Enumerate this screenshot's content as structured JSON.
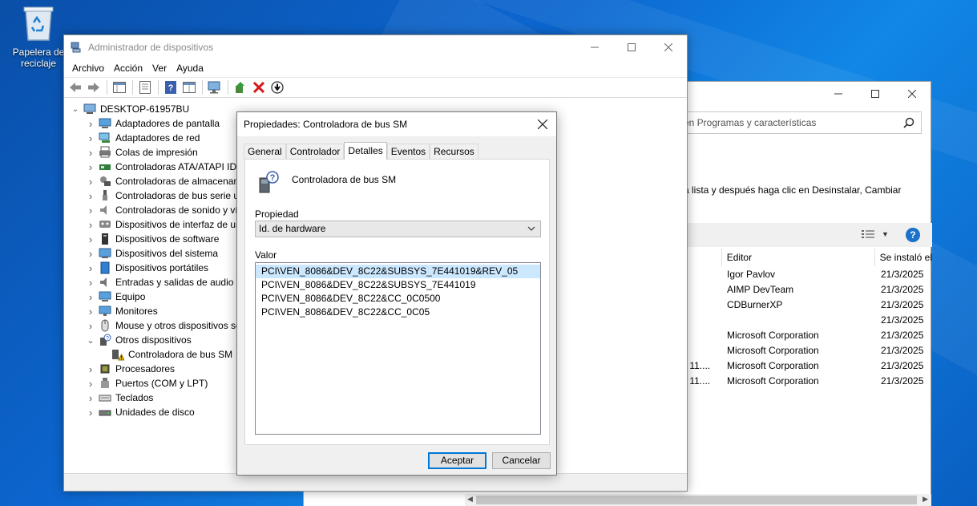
{
  "desktop": {
    "recycle_bin_label": "Papelera de reciclaje"
  },
  "programs_window": {
    "search_placeholder": "en Programas y características",
    "description": "a lista y después haga clic en Desinstalar, Cambiar",
    "columns": {
      "editor": "Editor",
      "installed": "Se instaló el"
    },
    "rows": [
      {
        "fragment": "",
        "editor": "Igor Pavlov",
        "date": "21/3/2025"
      },
      {
        "fragment": "",
        "editor": "AIMP DevTeam",
        "date": "21/3/2025"
      },
      {
        "fragment": "",
        "editor": "CDBurnerXP",
        "date": "21/3/2025"
      },
      {
        "fragment": "",
        "editor": "",
        "date": "21/3/2025"
      },
      {
        "fragment": "",
        "editor": "Microsoft Corporation",
        "date": "21/3/2025"
      },
      {
        "fragment": "",
        "editor": "Microsoft Corporation",
        "date": "21/3/2025"
      },
      {
        "fragment": "- 11....",
        "editor": "Microsoft Corporation",
        "date": "21/3/2025"
      },
      {
        "fragment": "- 11....",
        "editor": "Microsoft Corporation",
        "date": "21/3/2025"
      }
    ]
  },
  "device_manager": {
    "title": "Administrador de dispositivos",
    "menus": [
      "Archivo",
      "Acción",
      "Ver",
      "Ayuda"
    ],
    "root": "DESKTOP-61957BU",
    "categories": [
      {
        "label": "Adaptadores de pantalla",
        "icon": "display-adapter-icon"
      },
      {
        "label": "Adaptadores de red",
        "icon": "network-adapter-icon"
      },
      {
        "label": "Colas de impresión",
        "icon": "printer-icon"
      },
      {
        "label": "Controladoras ATA/ATAPI IDE",
        "icon": "ide-controller-icon"
      },
      {
        "label": "Controladoras de almacenamiento",
        "icon": "storage-controller-icon"
      },
      {
        "label": "Controladoras de bus serie universal",
        "icon": "usb-icon"
      },
      {
        "label": "Controladoras de sonido y vídeo",
        "icon": "sound-icon"
      },
      {
        "label": "Dispositivos de interfaz de usuario",
        "icon": "hid-icon"
      },
      {
        "label": "Dispositivos de software",
        "icon": "software-device-icon"
      },
      {
        "label": "Dispositivos del sistema",
        "icon": "system-device-icon"
      },
      {
        "label": "Dispositivos portátiles",
        "icon": "portable-device-icon"
      },
      {
        "label": "Entradas y salidas de audio",
        "icon": "audio-io-icon"
      },
      {
        "label": "Equipo",
        "icon": "computer-icon"
      },
      {
        "label": "Monitores",
        "icon": "monitor-icon"
      },
      {
        "label": "Mouse y otros dispositivos señaladores",
        "icon": "mouse-icon"
      },
      {
        "label": "Otros dispositivos",
        "icon": "other-devices-icon"
      },
      {
        "label": "Controladora de bus SM",
        "icon": "warning-device-icon"
      },
      {
        "label": "Procesadores",
        "icon": "processor-icon"
      },
      {
        "label": "Puertos (COM y LPT)",
        "icon": "port-icon"
      },
      {
        "label": "Teclados",
        "icon": "keyboard-icon"
      },
      {
        "label": "Unidades de disco",
        "icon": "disk-icon"
      }
    ]
  },
  "properties_dialog": {
    "title": "Propiedades: Controladora de bus SM",
    "tabs": [
      "General",
      "Controlador",
      "Detalles",
      "Eventos",
      "Recursos"
    ],
    "active_tab": "Detalles",
    "device_name": "Controladora de bus SM",
    "property_label": "Propiedad",
    "property_selected": "Id. de hardware",
    "value_label": "Valor",
    "values": [
      "PCI\\VEN_8086&DEV_8C22&SUBSYS_7E441019&REV_05",
      "PCI\\VEN_8086&DEV_8C22&SUBSYS_7E441019",
      "PCI\\VEN_8086&DEV_8C22&CC_0C0500",
      "PCI\\VEN_8086&DEV_8C22&CC_0C05"
    ],
    "ok_label": "Aceptar",
    "cancel_label": "Cancelar"
  }
}
